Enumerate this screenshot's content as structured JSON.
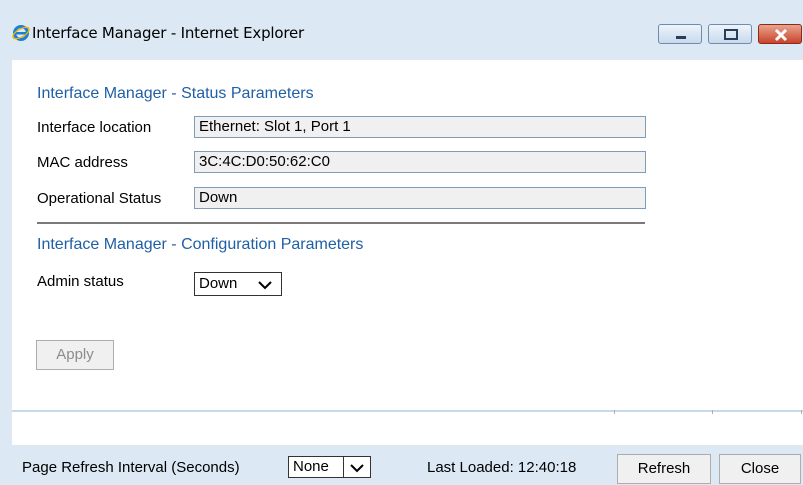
{
  "window": {
    "title": "Interface Manager - Internet Explorer",
    "app_icon": "internet-explorer-icon",
    "controls": [
      "minimize-icon",
      "maximize-icon",
      "close-icon"
    ]
  },
  "status_section": {
    "title": "Interface Manager - Status Parameters",
    "rows": [
      {
        "label": "Interface location",
        "value": "Ethernet: Slot 1, Port 1"
      },
      {
        "label": "MAC address",
        "value": "3C:4C:D0:50:62:C0"
      },
      {
        "label": "Operational Status",
        "value": "Down"
      }
    ]
  },
  "config_section": {
    "title": "Interface Manager - Configuration Parameters",
    "admin_status_label": "Admin status",
    "admin_status_value": "Down"
  },
  "apply_label": "Apply",
  "footer": {
    "refresh_interval_label": "Page Refresh Interval (Seconds)",
    "refresh_interval_value": "None",
    "last_loaded": "Last Loaded: 12:40:18",
    "refresh_label": "Refresh",
    "close_label": "Close"
  },
  "colors": {
    "section_title": "#1f5fa6",
    "chrome": "#dce8f3"
  }
}
